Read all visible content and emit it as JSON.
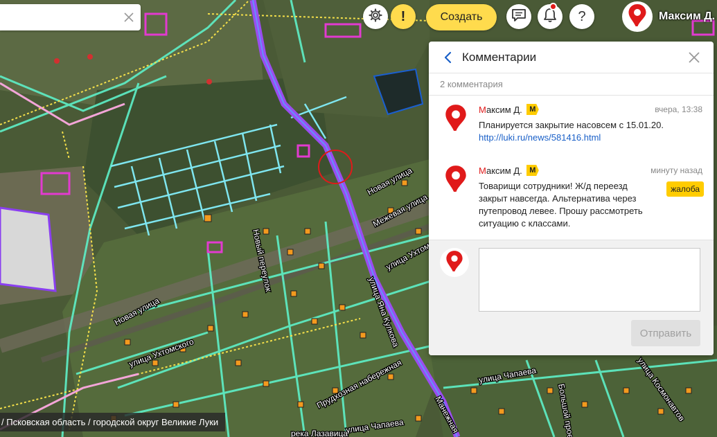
{
  "search": {
    "value": "",
    "placeholder": ""
  },
  "toolbar": {
    "warning_label": "!",
    "create_label": "Создать",
    "help_label": "?"
  },
  "user": {
    "name": "Максим Д."
  },
  "panel": {
    "title": "Комментарии",
    "count_text": "2 комментария",
    "comments": [
      {
        "author_first": "М",
        "author_rest": "аксим Д.",
        "badge": "М",
        "time": "вчера, 13:38",
        "text": "Планируется закрытие насовсем с 15.01.20.",
        "link": "http://luki.ru/news/581416.html"
      },
      {
        "author_first": "М",
        "author_rest": "аксим Д.",
        "badge": "М",
        "time": "минуту назад",
        "text": "Товарищи сотрудники! Ж/д переезд закрыт навсегда. Альтернатива через путепровод левее. Прошу рассмотреть ситуацию с классами.",
        "report_label": "жалоба"
      }
    ],
    "reply": {
      "value": "",
      "placeholder": ""
    },
    "send_label": "Отправить"
  },
  "map": {
    "street_labels": [
      "Новая улица",
      "Межевая улица",
      "улица Ухтомского",
      "Новый переулок",
      "улица Яна Кулкова",
      "Новая улица",
      "улица Ухтомского",
      "Прудхозная набережная",
      "улица Чапаева",
      "улица Чапаева",
      "Большой проезд",
      "улица Космонавтов",
      "Манежная",
      "река Лазавица"
    ]
  },
  "breadcrumb": {
    "text": "/ Псковская область / городской округ Великие Луки"
  },
  "colors": {
    "accent": "#ffdb4d",
    "link": "#1a60c8",
    "brand_red": "#e01a1a",
    "road_main": "#9a4df0",
    "road_secondary": "#5ef0c8"
  }
}
